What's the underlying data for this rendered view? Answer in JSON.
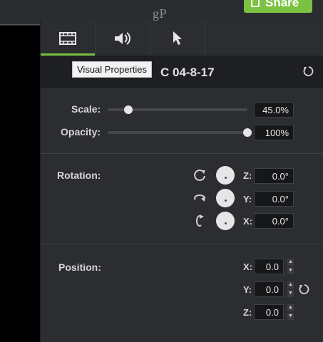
{
  "topbar": {
    "watermark": "gP",
    "share_label": "Share"
  },
  "tabs": [
    {
      "icon": "film-strip-icon",
      "active": true
    },
    {
      "icon": "speaker-icon",
      "active": false
    },
    {
      "icon": "cursor-icon",
      "active": false
    }
  ],
  "header": {
    "clip_name": "C 04-8-17",
    "tooltip": "Visual Properties"
  },
  "properties": {
    "scale": {
      "label": "Scale:",
      "value": "45.0%",
      "level": 0.15
    },
    "opacity": {
      "label": "Opacity:",
      "value": "100%",
      "level": 1.0
    },
    "rotation": {
      "label": "Rotation:",
      "z_label": "Z:",
      "z_value": "0.0°",
      "y_label": "Y:",
      "y_value": "0.0°",
      "x_label": "X:",
      "x_value": "0.0°"
    },
    "position": {
      "label": "Position:",
      "x_label": "X:",
      "x_value": "0.0",
      "y_label": "Y:",
      "y_value": "0.0",
      "z_label": "Z:",
      "z_value": "0.0"
    }
  },
  "colors": {
    "accent": "#7cc242",
    "panel": "#2b2d31"
  }
}
